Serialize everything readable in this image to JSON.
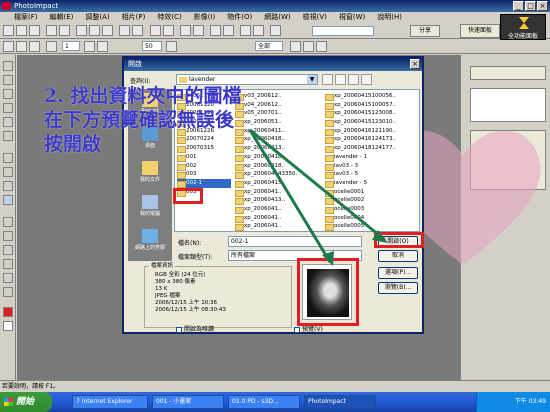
{
  "app": {
    "title": "PhotoImpact",
    "window_buttons": [
      "_",
      "□",
      "×"
    ]
  },
  "menubar": [
    "檔案(F)",
    "編輯(E)",
    "調整(A)",
    "相片(P)",
    "特效(C)",
    "影像(I)",
    "物件(O)",
    "網路(W)",
    "檢視(V)",
    "視窗(W)",
    "說明(H)"
  ],
  "toolbar": {
    "zoom1": "1",
    "zoom2": "50",
    "mode": "全部",
    "share_label": "分享",
    "quick_label": "快速面板",
    "expert_label": "全功能面板"
  },
  "dialog": {
    "title": "開啟",
    "close": "×",
    "look_in_label": "查詢(I):",
    "look_in_value": "lavender",
    "places": [
      "Recent",
      "桌面",
      "我的文件",
      "我的電腦",
      "網路上的芳鄰"
    ],
    "files_col1": [
      "20061119",
      "20061120",
      "20061129",
      "20061207",
      "20061226",
      "20070224",
      "20070315",
      "001",
      "002",
      "003",
      "002-1",
      "003"
    ],
    "files_col2": [
      "v03_200612..",
      "v04_200612..",
      "v05_200701..",
      "xp_2006051..",
      "xp_20060411..",
      "xp_20060418..",
      "xp_20060413..",
      "xp_20060418..",
      "xp_20060418..",
      "xp_200604143350..",
      "xp_20060415..",
      "xp_2006041..",
      "xp_20060413..",
      "xp_2006041..",
      "xp_2006041..",
      "xp_2006041.."
    ],
    "files_col3": [
      "xp_20060415100056..",
      "xp_20060415100057..",
      "xp_20060415123008..",
      "xp_20060415123010..",
      "xp_20060416121190..",
      "xp_20060416124173..",
      "xp_20060418124177..",
      "lavender - 1",
      "lav03 - 3",
      "lav03 - 5",
      "lavender - 5",
      "ocelle0001",
      "ocelle0002",
      "ocelle0003",
      "ocelle0004",
      "ocelle0005"
    ],
    "selected_index": 10,
    "filename_label": "檔名(N):",
    "filename_value": "002-1",
    "filetype_label": "檔案類型(T):",
    "filetype_value": "所有檔案",
    "open_button": "開啟(O)",
    "cancel_button": "取消",
    "button3": "選項(P)...",
    "button4": "瀏覽(B)...",
    "info_legend": "檔案資訊",
    "info_lines": [
      "RGB 全彩 (24 位元)",
      "380 x 380 像素",
      "13 K",
      "JPEG 檔案",
      "2006/12/15 上午 10:36",
      "2006/12/15 上午 08:30:43"
    ],
    "checkbox1": "開啟為唯讀",
    "checkbox2": "預覽(V)"
  },
  "annotation": {
    "text": "2. 找出資料夾中的圖檔\n在下方預覽確認無誤後\n按開啟",
    "color": "#3c39c8",
    "box_color": "#e02020"
  },
  "statusbar": {
    "text": "若要說明，請按 F1。"
  },
  "taskbar": {
    "start_label": "開始",
    "tasks": [
      "7 Internet Explorer",
      "001 - 小畫家",
      "01.0 PD - s3D...",
      "PhotoImpact"
    ],
    "clock": "下午 03:49"
  }
}
